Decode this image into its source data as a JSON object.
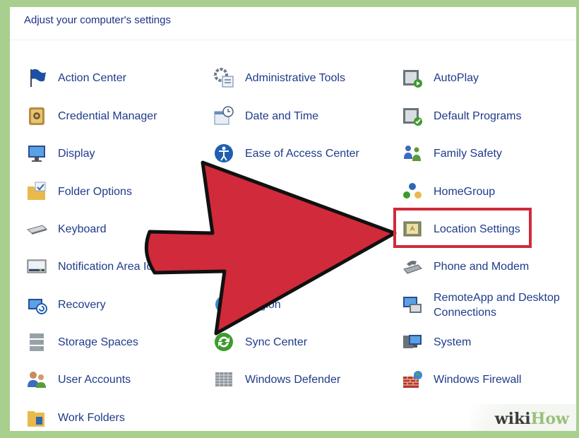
{
  "header": {
    "title": "Adjust your computer's settings"
  },
  "items": [
    {
      "label": "Action Center",
      "icon": "action-center-flag-icon"
    },
    {
      "label": "Credential Manager",
      "icon": "credential-vault-icon"
    },
    {
      "label": "Display",
      "icon": "monitor-icon"
    },
    {
      "label": "Folder Options",
      "icon": "folder-options-icon"
    },
    {
      "label": "Keyboard",
      "icon": "keyboard-icon"
    },
    {
      "label": "Notification Area Icons",
      "icon": "notification-tray-icon"
    },
    {
      "label": "Recovery",
      "icon": "recovery-icon"
    },
    {
      "label": "Storage Spaces",
      "icon": "storage-drives-icon"
    },
    {
      "label": "User Accounts",
      "icon": "user-accounts-icon"
    },
    {
      "label": "Work Folders",
      "icon": "work-folders-icon"
    },
    {
      "label": "Administrative Tools",
      "icon": "administrative-tools-icon"
    },
    {
      "label": "Date and Time",
      "icon": "calendar-clock-icon"
    },
    {
      "label": "Ease of Access Center",
      "icon": "ease-of-access-icon"
    },
    {
      "label": "",
      "icon": "hidden-item-icon"
    },
    {
      "label": "",
      "icon": "hidden-item-icon"
    },
    {
      "label": "",
      "icon": "hidden-item-icon"
    },
    {
      "label": "Region",
      "icon": "region-icon"
    },
    {
      "label": "Sync Center",
      "icon": "sync-center-icon"
    },
    {
      "label": "Windows Defender",
      "icon": "windows-defender-icon"
    },
    {
      "label": "AutoPlay",
      "icon": "autoplay-icon"
    },
    {
      "label": "Default Programs",
      "icon": "default-programs-icon"
    },
    {
      "label": "Family Safety",
      "icon": "family-safety-icon"
    },
    {
      "label": "HomeGroup",
      "icon": "homegroup-icon"
    },
    {
      "label": "Location Settings",
      "icon": "location-settings-icon"
    },
    {
      "label": "Phone and Modem",
      "icon": "phone-modem-icon"
    },
    {
      "label": "RemoteApp and Desktop Connections",
      "icon": "remoteapp-icon"
    },
    {
      "label": "System",
      "icon": "system-icon"
    },
    {
      "label": "Windows Firewall",
      "icon": "firewall-icon"
    }
  ],
  "overlay": {
    "highlighted_item": "Location Settings",
    "arrow_color": "#d12a3a"
  },
  "watermark": {
    "part1": "wiki",
    "part2": "How"
  },
  "colors": {
    "link_text": "#1f3b8a",
    "frame": "#a9cf8e",
    "highlight": "#d12a3a"
  }
}
